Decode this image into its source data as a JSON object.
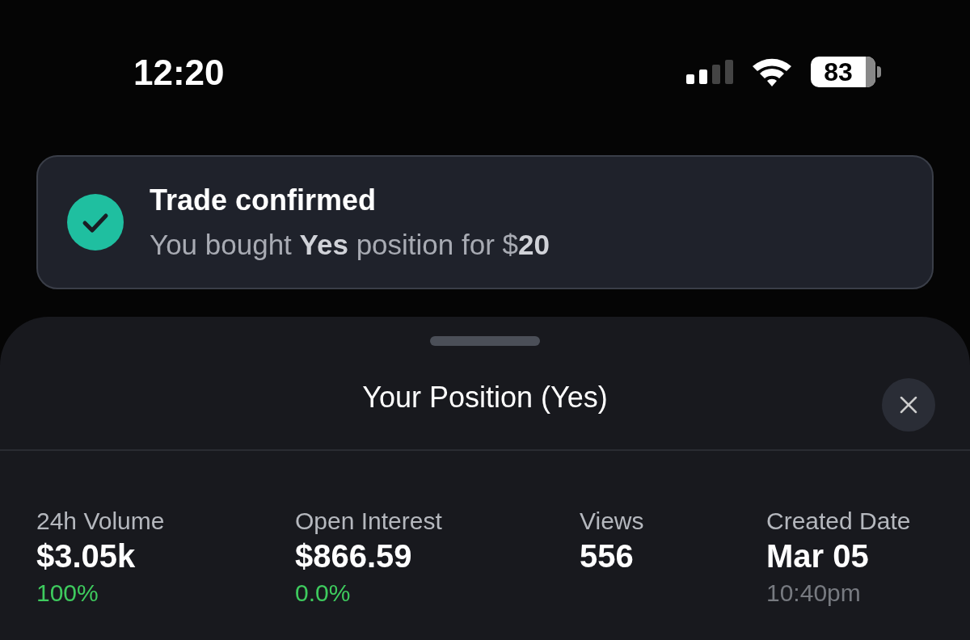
{
  "status_bar": {
    "time": "12:20",
    "battery": "83"
  },
  "toast": {
    "title": "Trade confirmed",
    "message": "You bought **Yes** position for $**20**"
  },
  "sheet": {
    "title": "Your Position (Yes)",
    "stats": [
      {
        "label": "24h Volume",
        "value": "$3.05k",
        "change": "100%"
      },
      {
        "label": "Open Interest",
        "value": "$866.59",
        "change": "0.0%"
      },
      {
        "label": "Views",
        "value": "556"
      },
      {
        "label": "Created Date",
        "value": "Mar 05",
        "time": "10:40pm"
      }
    ]
  }
}
